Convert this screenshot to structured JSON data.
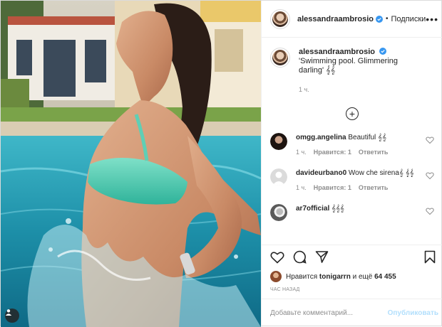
{
  "post": {
    "author": "alessandraambrosio",
    "follow_label": "Подписки",
    "separator": "•",
    "more_icon": "more-dots-icon",
    "caption": {
      "text": "'Swimming pool. Glimmering darling' 𝄞𝄞",
      "time": "1 ч."
    },
    "load_more_icon": "plus-circle-icon",
    "comments": [
      {
        "user": "omgg.angelina",
        "text": "Beautiful 𝄞𝄞",
        "time": "1 ч.",
        "likes": "Нравится: 1",
        "reply": "Ответить"
      },
      {
        "user": "davideurbano0",
        "text": "Wow che sirena𝄞 𝄞𝄞",
        "time": "1 ч.",
        "likes": "Нравится: 1",
        "reply": "Ответить"
      },
      {
        "user": "ar7official",
        "text": "𝄞𝄞𝄞",
        "time": "",
        "likes": "",
        "reply": ""
      }
    ],
    "likes_prefix": "Нравится",
    "likes_user": "tonigarrn",
    "likes_suffix": "и ещё",
    "likes_count": "64 455",
    "timeago": "ЧАС НАЗАД",
    "comment_placeholder": "Добавьте комментарий...",
    "publish_label": "Опубликовать"
  },
  "colors": {
    "verified": "#3897f0",
    "publish_disabled": "#b2dffc",
    "muted": "#8e8e8e",
    "text": "#262626"
  }
}
